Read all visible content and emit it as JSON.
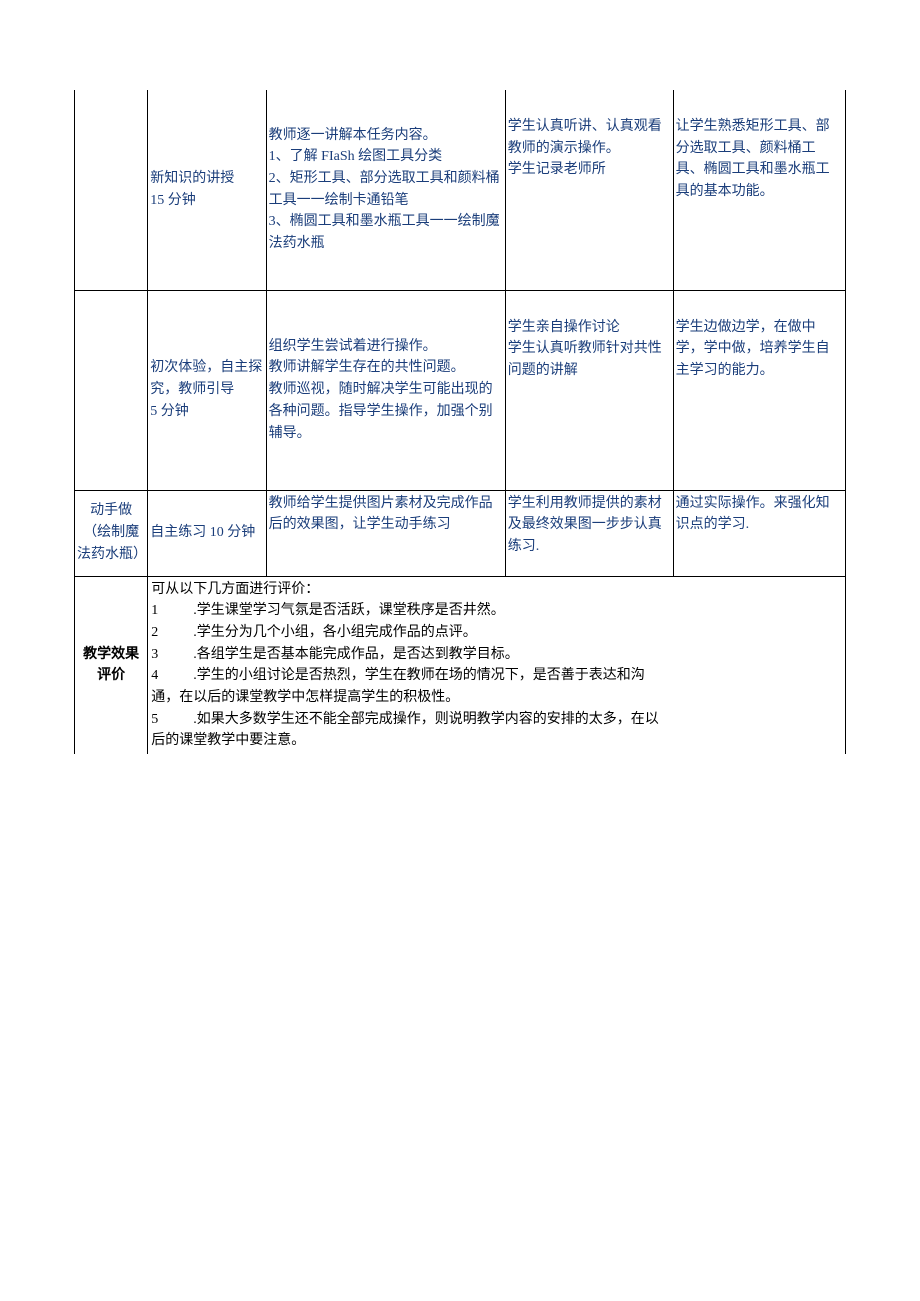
{
  "rows": {
    "r1": {
      "phase": "",
      "time_label_1": "新知识的讲授",
      "time_label_2": "15 分钟",
      "teacher_l1": "教师逐一讲解本任务内容。",
      "teacher_l2": "1、了解 FIaSh 绘图工具分类",
      "teacher_l3": "2、矩形工具、部分选取工具和颜料桶工具一一绘制卡通铅笔",
      "teacher_l4": "3、椭圆工具和墨水瓶工具一一绘制魔法药水瓶",
      "student_l1": "学生认真听讲、认真观看教师的演示操作。",
      "student_l2": "学生记录老师所",
      "purpose": "让学生熟悉矩形工具、部分选取工具、颜料桶工具、椭圆工具和墨水瓶工具的基本功能。"
    },
    "r2": {
      "time_label_1": "初次体验，自主探究，教师引导",
      "time_label_2": "5 分钟",
      "teacher_l1": "组织学生尝试着进行操作。",
      "teacher_l2": "教师讲解学生存在的共性问题。",
      "teacher_l3": "教师巡视，随时解决学生可能出现的各种问题。指导学生操作，加强个别辅导。",
      "student_l1": "学生亲自操作讨论",
      "student_l2": "学生认真听教师针对共性问题的讲解",
      "purpose": "学生边做边学，在做中学，学中做，培养学生自主学习的能力。"
    },
    "r3": {
      "phase_l1": "动手做",
      "phase_l2": "（绘制魔法药水瓶）",
      "time_label": "自主练习 10 分钟",
      "teacher": "教师给学生提供图片素材及完成作品后的效果图，让学生动手练习",
      "student": "学生利用教师提供的素材及最终效果图一步步认真练习",
      "purpose": "通过实际操作。来强化知识点的学习"
    },
    "eval": {
      "label": "教学效果评价",
      "intro": "可从以下几方面进行评价：",
      "i1": ".学生课堂学习气氛是否活跃，课堂秩序是否井然。",
      "i2": ".学生分为几个小组，各小组完成作品的点评。",
      "i3": ".各组学生是否基本能完成作品，是否达到教学目标。",
      "i4a": ".学生的小组讨论是否热烈，学生在教师在场的情况下，是否善于表达和沟",
      "i4b": "通，在以后的课堂教学中怎样提高学生的积极性。",
      "i5a": ".如果大多数学生还不能全部完成操作，则说明教学内容的安排的太多，在以",
      "i5b": "后的课堂教学中要注意。",
      "n1": "1",
      "n2": "2",
      "n3": "3",
      "n4": "4",
      "n5": "5"
    }
  }
}
